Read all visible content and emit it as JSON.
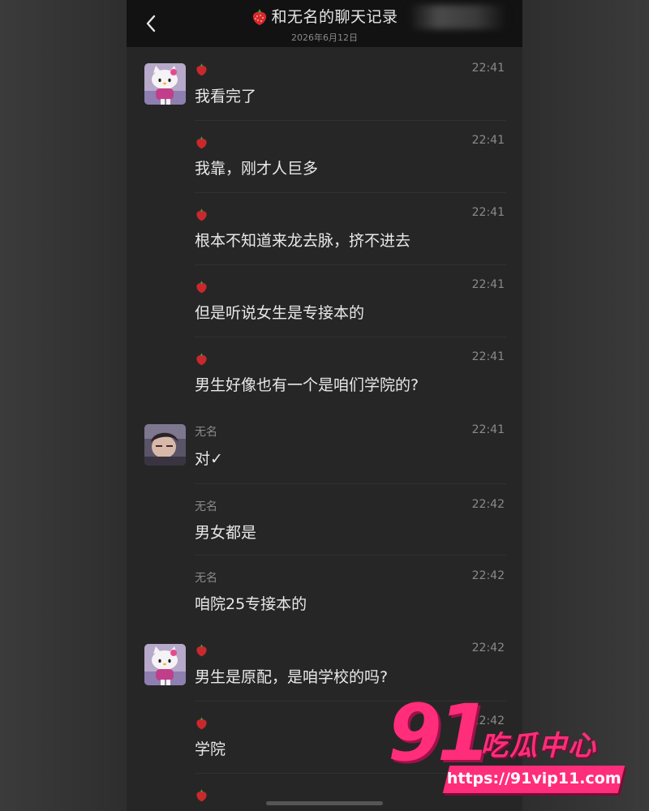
{
  "header": {
    "title": "和无名的聊天记录",
    "date": "2026年6月12日"
  },
  "messages": [
    {
      "sender": "",
      "time": "22:41",
      "text": "我看完了"
    },
    {
      "sender": "",
      "time": "22:41",
      "text": "我靠，刚才人巨多"
    },
    {
      "sender": "",
      "time": "22:41",
      "text": "根本不知道来龙去脉，挤不进去"
    },
    {
      "sender": "",
      "time": "22:41",
      "text": "但是听说女生是专接本的"
    },
    {
      "sender": "",
      "time": "22:41",
      "text": "男生好像也有一个是咱们学院的?"
    },
    {
      "sender": "无名",
      "time": "22:41",
      "text": "对✓"
    },
    {
      "sender": "无名",
      "time": "22:42",
      "text": "男女都是"
    },
    {
      "sender": "无名",
      "time": "22:42",
      "text": "咱院25专接本的"
    },
    {
      "sender": "",
      "time": "22:42",
      "text": "男生是原配，是咱学校的吗?"
    },
    {
      "sender": "",
      "time": "22:42",
      "text": "学院"
    },
    {
      "sender": "",
      "time": "",
      "text": ""
    }
  ],
  "watermark": {
    "logo_number": "91",
    "logo_text": "吃瓜中心",
    "url": "https://91vip11.com"
  },
  "colors": {
    "background": "#2e2e2e",
    "chat_background": "#262626",
    "header_background": "#121212",
    "watermark_pink": "#ff2d7a"
  }
}
